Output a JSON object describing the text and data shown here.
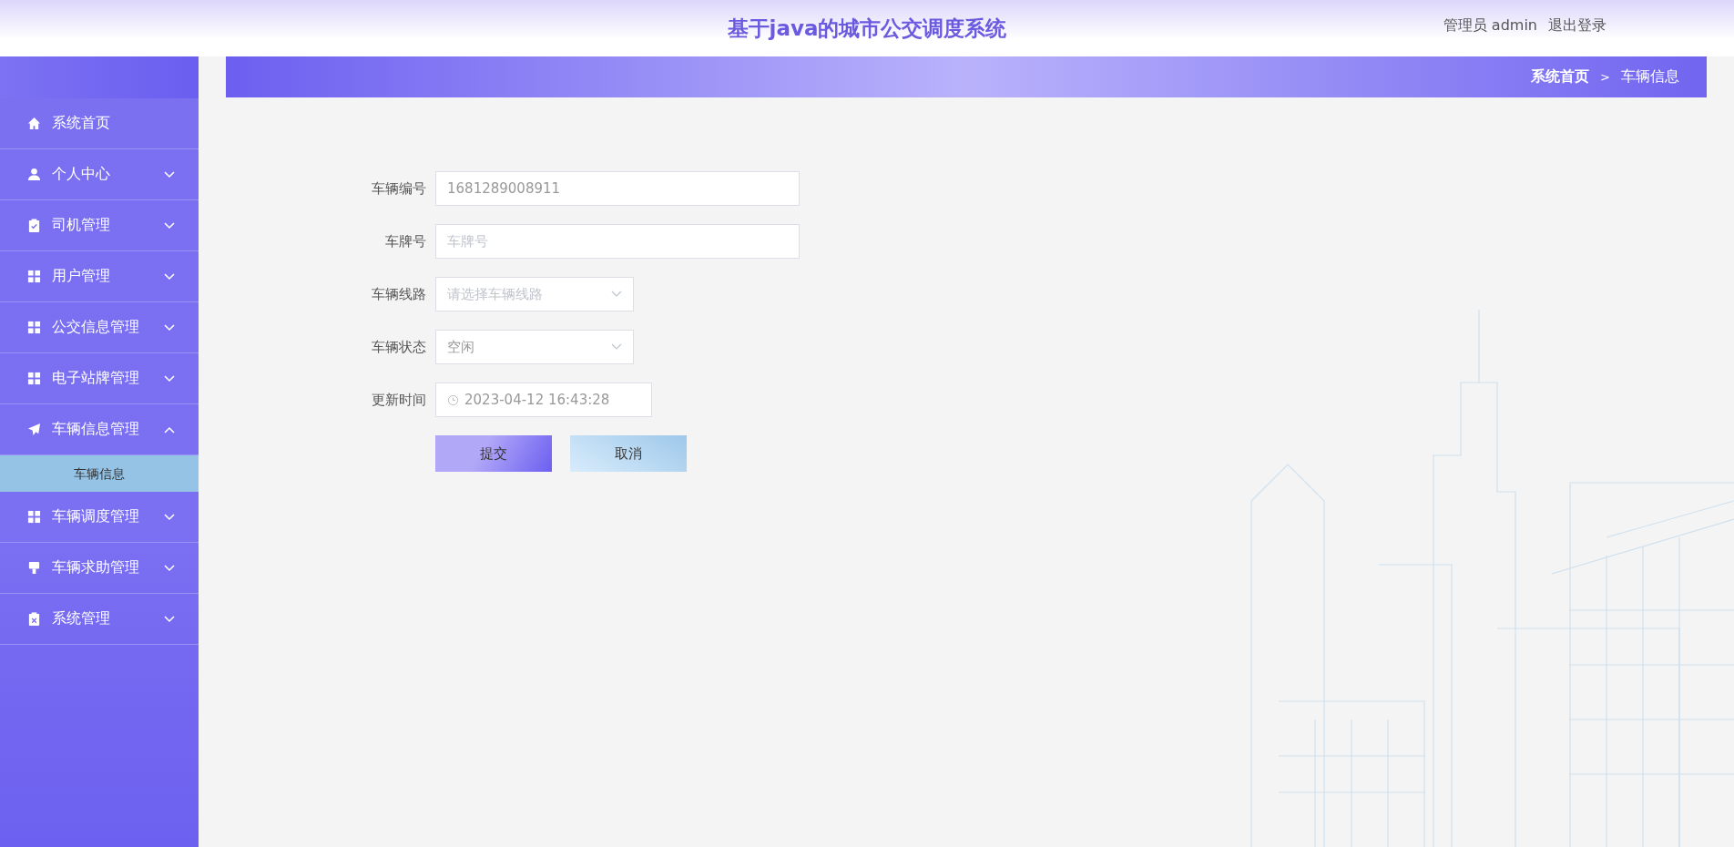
{
  "header": {
    "title": "基于java的城市公交调度系统",
    "user": "管理员 admin",
    "logout": "退出登录"
  },
  "sidebar": {
    "items": [
      {
        "label": "系统首页",
        "kind": "link"
      },
      {
        "label": "个人中心",
        "kind": "menu",
        "expanded": false
      },
      {
        "label": "司机管理",
        "kind": "menu",
        "expanded": false
      },
      {
        "label": "用户管理",
        "kind": "menu",
        "expanded": false
      },
      {
        "label": "公交信息管理",
        "kind": "menu",
        "expanded": false
      },
      {
        "label": "电子站牌管理",
        "kind": "menu",
        "expanded": false
      },
      {
        "label": "车辆信息管理",
        "kind": "menu",
        "expanded": true,
        "children": [
          {
            "label": "车辆信息",
            "selected": true
          }
        ]
      },
      {
        "label": "车辆调度管理",
        "kind": "menu",
        "expanded": false
      },
      {
        "label": "车辆求助管理",
        "kind": "menu",
        "expanded": false
      },
      {
        "label": "系统管理",
        "kind": "menu",
        "expanded": false
      }
    ]
  },
  "breadcrumb": [
    {
      "label": "系统首页",
      "current": false
    },
    {
      "label": "车辆信息",
      "current": true
    }
  ],
  "breadcrumb_separator": ">",
  "form": {
    "fields": [
      {
        "label": "车辆编号",
        "kind": "input",
        "value": "1681289008911"
      },
      {
        "label": "车牌号",
        "kind": "input",
        "placeholder": "车牌号"
      },
      {
        "label": "车辆线路",
        "kind": "select",
        "placeholder": "请选择车辆线路"
      },
      {
        "label": "车辆状态",
        "kind": "select",
        "value": "空闲"
      },
      {
        "label": "更新时间",
        "kind": "date",
        "value": "2023-04-12 16:43:28"
      }
    ],
    "buttons": [
      {
        "label": "提交",
        "kind": "primary"
      },
      {
        "label": "取消",
        "kind": "secondary"
      }
    ]
  }
}
